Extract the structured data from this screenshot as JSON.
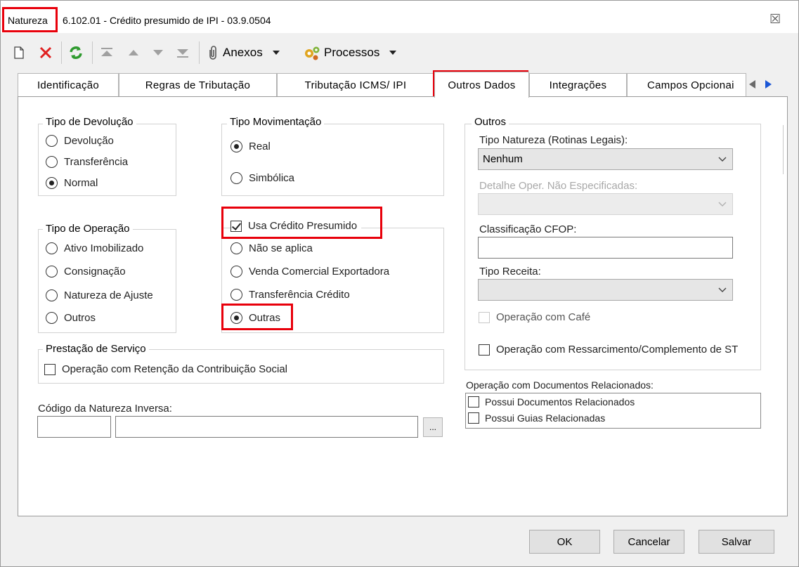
{
  "window": {
    "title_prefix": "Natureza",
    "title_text": "6.102.01 - Crédito presumido de IPI - 03.9.0504",
    "close_glyph": "☒"
  },
  "toolbar": {
    "anexos_label": "Anexos",
    "processos_label": "Processos"
  },
  "tabs": [
    {
      "label": "Identificação"
    },
    {
      "label": "Regras de Tributação"
    },
    {
      "label": "Tributação ICMS/ IPI"
    },
    {
      "label": "Outros Dados",
      "active": true
    },
    {
      "label": "Integrações"
    },
    {
      "label": "Campos Opcionai"
    }
  ],
  "tipo_devolucao": {
    "label": "Tipo de Devolução",
    "options": [
      "Devolução",
      "Transferência",
      "Normal"
    ],
    "selected": "Normal"
  },
  "tipo_movimentacao": {
    "label": "Tipo Movimentação",
    "options": [
      "Real",
      "Simbólica"
    ],
    "selected": "Real"
  },
  "tipo_operacao": {
    "label": "Tipo de Operação",
    "options": [
      "Ativo Imobilizado",
      "Consignação",
      "Natureza de Ajuste",
      "Outros"
    ]
  },
  "credito_presumido": {
    "checkbox_label": "Usa Crédito Presumido",
    "checked": true,
    "options": [
      "Não se aplica",
      "Venda Comercial Exportadora",
      "Transferência Crédito",
      "Outras"
    ],
    "selected": "Outras"
  },
  "prestacao_servico": {
    "label": "Prestação de Serviço",
    "checkbox_label": "Operação com Retenção da Contribuição Social"
  },
  "natureza_inversa": {
    "label": "Código da Natureza Inversa:",
    "lookup_label": "..."
  },
  "outros": {
    "label": "Outros",
    "tipo_natureza_label": "Tipo Natureza (Rotinas Legais):",
    "tipo_natureza_value": "Nenhum",
    "detalhe_label": "Detalhe Oper. Não Especificadas:",
    "classificacao_label": "Classificação CFOP:",
    "tipo_receita_label": "Tipo Receita:",
    "cafe_label": "Operação com Café",
    "ressarcimento_label": "Operação com Ressarcimento/Complemento de ST"
  },
  "documentos": {
    "label": "Operação com Documentos Relacionados:",
    "items": [
      "Possui Documentos Relacionados",
      "Possui Guias Relacionadas"
    ]
  },
  "buttons": {
    "ok": "OK",
    "cancelar": "Cancelar",
    "salvar": "Salvar"
  },
  "colors": {
    "highlight": "#e8000b",
    "refresh_green": "#2e9a2e",
    "delete_red": "#e02020",
    "nav_blue": "#1a56d6"
  }
}
